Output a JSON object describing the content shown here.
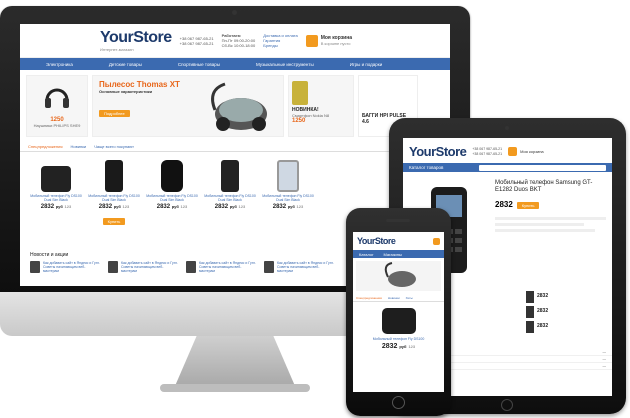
{
  "store": {
    "logo": "YourStore",
    "tagline": "Интернет-магазин",
    "phones": [
      "+38 067 987-65-21",
      "+38 067 987-65-21"
    ],
    "hours_title": "Работаем",
    "hours": [
      "Пн-Пт 09:00-20:00",
      "Сб-Вс 10:00-18:00"
    ],
    "links": [
      "Доставка и оплата",
      "Гарантия",
      "Бренды"
    ],
    "cart_title": "Моя корзина",
    "cart_text": "В корзине пусто"
  },
  "nav": [
    "Электроника",
    "Детские товары",
    "Спортивные товары",
    "Музыкальные инструменты",
    "Игры и подарки"
  ],
  "banners": {
    "headphones_price": "1250",
    "headphones_name": "Наушники PHILIPS SHE9",
    "vacuum_title": "Пылесос Thomas XT",
    "vacuum_sub": "Основные характеристики",
    "vacuum_button": "Подробнее",
    "phone_new": "НОВИНКА!",
    "phone_name": "Смартфон Nokia N8",
    "phone_price": "1250",
    "bike_title": "БАГГИ HPI PULSE 4.6"
  },
  "tabs": [
    "Спецпредложения",
    "Новинки",
    "Чаще всего покупают"
  ],
  "product": {
    "name": "Мобильный телефон Fly DS100",
    "variant": "Dual Sim Black",
    "price": "2832",
    "currency": "руб",
    "old_price": "123",
    "buy": "Купить",
    "compare": "Сравнить",
    "wish": "В избранное"
  },
  "products": [
    "camera",
    "phone",
    "lens",
    "speaker",
    "tablet",
    "phone2"
  ],
  "news_title": "Новости и акции",
  "news_item": "Как добавить сайт в Яндекс и Гугл. Советы начинающим веб-мастерам",
  "news_date": "22 апреля 2013",
  "ipad": {
    "title": "Мобильный телефон Samsung GT-E1282 Duos BKT",
    "price": "2832",
    "buy": "Купить",
    "specs_title": "Характеристики",
    "menu_catalog": "Каталог товаров",
    "search_placeholder": "Поиск"
  },
  "iphone": {
    "menu": "Каталог",
    "shops": "Магазины",
    "tabs": [
      "Спецпредложения",
      "Новинки",
      "Хиты"
    ]
  },
  "colors": {
    "brand": "#3b6ab0",
    "accent": "#f29a1f",
    "logo": "#1d3a6b"
  }
}
